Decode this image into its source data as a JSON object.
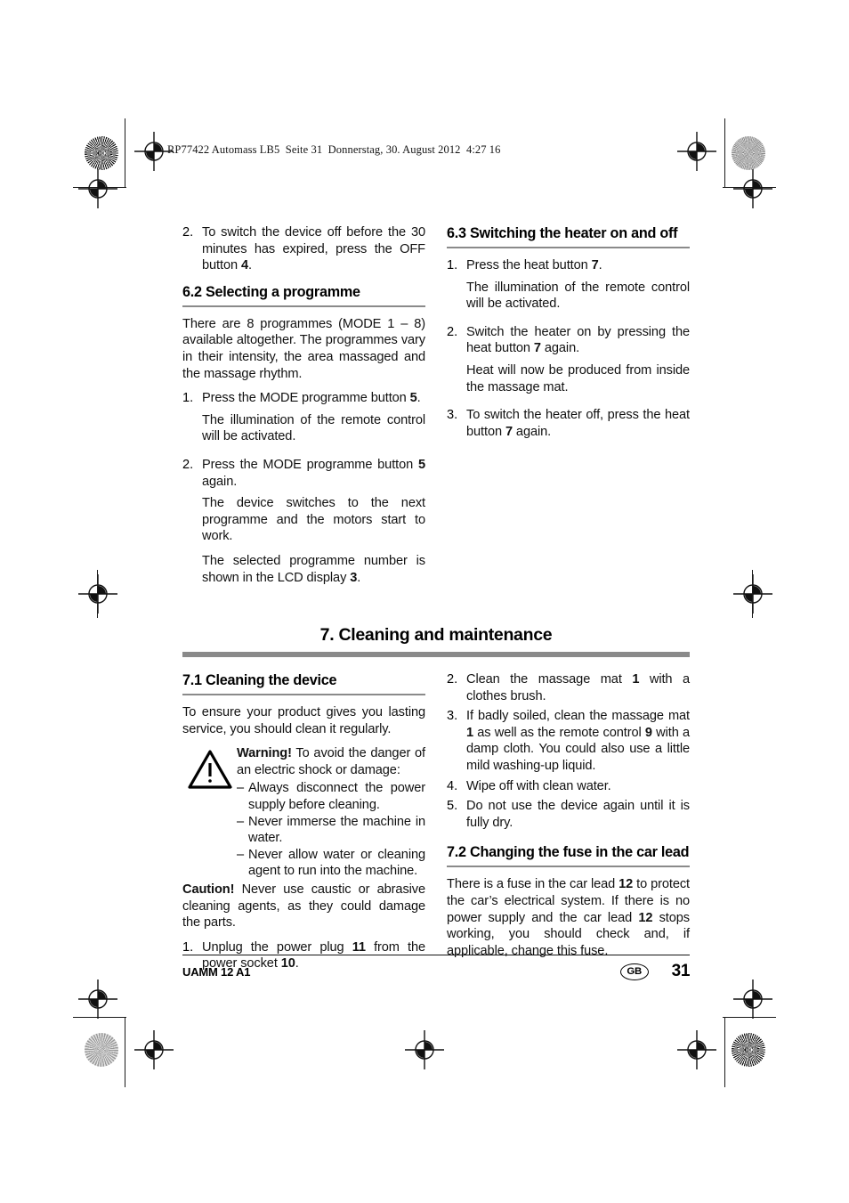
{
  "print_header": "RP77422 Automass LB5  Seite 31  Donnerstag, 30. August 2012  4:27 16",
  "colors": {
    "rule": "#8a8a8a",
    "text": "#111111",
    "footer_rule": "#141414"
  },
  "left_column": {
    "top_item": {
      "number": "2.",
      "text_1": "To switch the device off before the 30 minutes has expired, press the OFF button ",
      "bold_1": "4",
      "text_2": "."
    },
    "section_62": {
      "heading": "6.2 Selecting a programme",
      "intro": "There are 8 programmes (MODE 1 – 8) available altogether. The programmes vary in their intensity, the area massaged and the massage rhythm.",
      "items": [
        {
          "number": "1.",
          "text_1": "Press the MODE programme button ",
          "bold_1": "5",
          "text_2": ".",
          "sub": [
            "The illumination of the remote control will be activated."
          ]
        },
        {
          "number": "2.",
          "text_1": "Press the MODE programme button ",
          "bold_1": "5",
          "text_2": " again.",
          "sub": [
            "The device switches to the next programme and the motors start to work.",
            "The selected programme number is shown in the LCD display 3."
          ]
        }
      ]
    },
    "section_71": {
      "heading": "7.1 Cleaning the device",
      "intro": "To ensure your product gives you lasting service, you should clean it regularly.",
      "warning_label": "Warning!",
      "warning_text": " To avoid the danger of an electric shock or damage:",
      "warning_items": [
        "Always disconnect the power supply before cleaning.",
        "Never immerse the machine in water.",
        "Never allow water or cleaning agent to run into the machine."
      ],
      "caution_label": "Caution!",
      "caution_text": " Never use caustic or abrasive cleaning agents, as they could damage the parts.",
      "item_1": {
        "number": "1.",
        "text_1": "Unplug the power plug ",
        "bold_1": "11",
        "text_2": " from the power socket ",
        "bold_2": "10",
        "text_3": "."
      }
    }
  },
  "right_column": {
    "section_63": {
      "heading": "6.3 Switching the heater on and off",
      "items": [
        {
          "number": "1.",
          "text_1": "Press the heat button ",
          "bold_1": "7",
          "text_2": ".",
          "sub": [
            "The illumination of the remote control will be activated."
          ]
        },
        {
          "number": "2.",
          "text_1": "Switch the heater on by pressing the heat button ",
          "bold_1": "7",
          "text_2": " again.",
          "sub": [
            "Heat will now be produced from inside the massage mat."
          ]
        },
        {
          "number": "3.",
          "text_1": "To switch the heater off, press the heat button ",
          "bold_1": "7",
          "text_2": " again.",
          "sub": []
        }
      ]
    },
    "cleaning_items": [
      {
        "number": "2.",
        "text_1": "Clean the massage mat ",
        "bold_1": "1",
        "text_2": " with a clothes brush."
      },
      {
        "number": "3.",
        "text_1": "If badly soiled, clean the massage mat ",
        "bold_1": "1",
        "text_2": " as well as the remote control ",
        "bold_2": "9",
        "text_3": " with a damp cloth. You could also use a little mild washing-up liquid."
      },
      {
        "number": "4.",
        "text_1": "Wipe off with clean water.",
        "bold_1": "",
        "text_2": ""
      },
      {
        "number": "5.",
        "text_1": "Do not use the device again until it is fully dry.",
        "bold_1": "",
        "text_2": ""
      }
    ],
    "section_72": {
      "heading": "7.2 Changing the fuse in the car lead",
      "text_1": "There is a fuse in the car lead ",
      "bold_1": "12",
      "text_2": " to protect the car’s electrical system. If there is no power supply and the car lead ",
      "bold_2": "12",
      "text_3": " stops working, you should check and, if applicable, change this fuse."
    }
  },
  "chapter": {
    "heading": "7. Cleaning and maintenance"
  },
  "footer": {
    "model": "UAMM 12 A1",
    "locale_badge": "GB",
    "page_number": "31"
  }
}
